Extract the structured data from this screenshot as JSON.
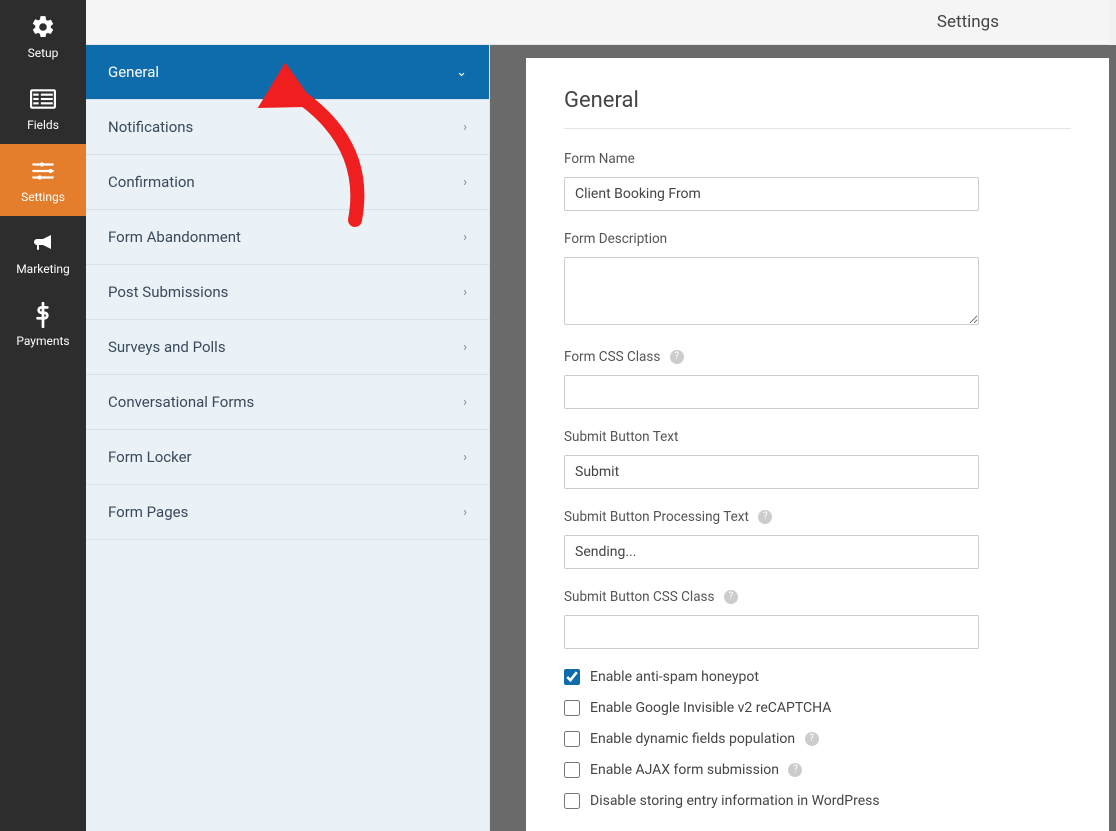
{
  "header": {
    "title": "Settings"
  },
  "sidebar": {
    "items": [
      {
        "name": "setup",
        "label": "Setup"
      },
      {
        "name": "fields",
        "label": "Fields"
      },
      {
        "name": "settings",
        "label": "Settings"
      },
      {
        "name": "marketing",
        "label": "Marketing"
      },
      {
        "name": "payments",
        "label": "Payments"
      }
    ]
  },
  "settings_list": {
    "items": [
      {
        "label": "General",
        "active": true
      },
      {
        "label": "Notifications"
      },
      {
        "label": "Confirmation"
      },
      {
        "label": "Form Abandonment"
      },
      {
        "label": "Post Submissions"
      },
      {
        "label": "Surveys and Polls"
      },
      {
        "label": "Conversational Forms"
      },
      {
        "label": "Form Locker"
      },
      {
        "label": "Form Pages"
      }
    ]
  },
  "content": {
    "title": "General",
    "form_name": {
      "label": "Form Name",
      "value": "Client Booking From"
    },
    "form_description": {
      "label": "Form Description",
      "value": ""
    },
    "form_css_class": {
      "label": "Form CSS Class",
      "value": ""
    },
    "submit_text": {
      "label": "Submit Button Text",
      "value": "Submit"
    },
    "submit_processing": {
      "label": "Submit Button Processing Text",
      "value": "Sending..."
    },
    "submit_css": {
      "label": "Submit Button CSS Class",
      "value": ""
    },
    "checkboxes": [
      {
        "label": "Enable anti-spam honeypot",
        "checked": true
      },
      {
        "label": "Enable Google Invisible v2 reCAPTCHA",
        "checked": false
      },
      {
        "label": "Enable dynamic fields population",
        "checked": false,
        "help": true
      },
      {
        "label": "Enable AJAX form submission",
        "checked": false,
        "help": true
      },
      {
        "label": "Disable storing entry information in WordPress",
        "checked": false
      }
    ]
  }
}
